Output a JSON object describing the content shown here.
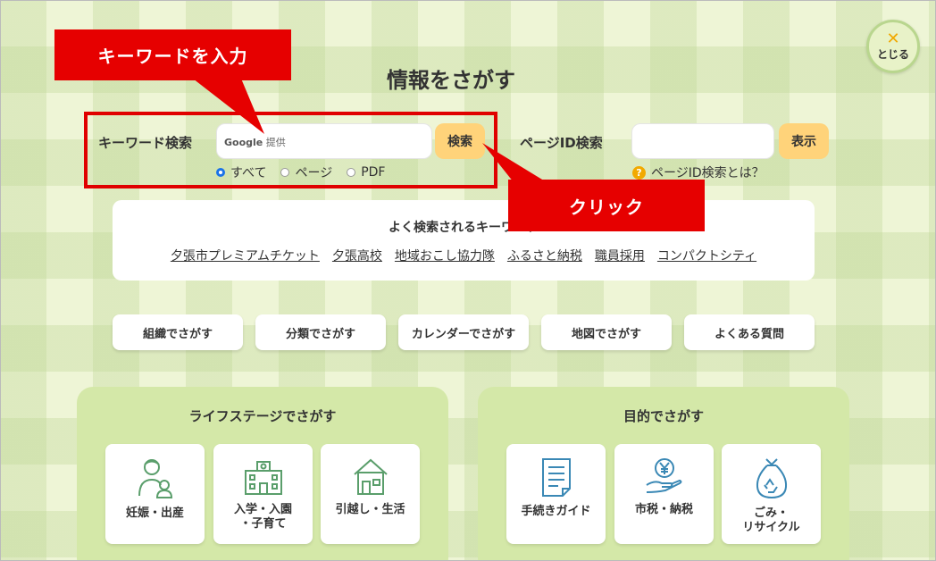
{
  "close": {
    "label": "とじる"
  },
  "page_title": "情報をさがす",
  "keyword_search": {
    "label": "キーワード検索",
    "google_tag_brand": "Google",
    "google_tag_text": "提供",
    "button": "検索",
    "radios": [
      {
        "label": "すべて",
        "checked": true
      },
      {
        "label": "ページ",
        "checked": false
      },
      {
        "label": "PDF",
        "checked": false
      }
    ]
  },
  "pageid_search": {
    "label": "ページID検索",
    "button": "表示",
    "help": "ページID検索とは？"
  },
  "annotations": {
    "keyword_input": "キーワードを入力",
    "click": "クリック",
    "color": "#e60000"
  },
  "popular": {
    "title": "よく検索されるキーワード",
    "links": [
      "夕張市プレミアムチケット",
      "夕張高校",
      "地域おこし協力隊",
      "ふるさと納税",
      "職員採用",
      "コンパクトシティ"
    ]
  },
  "nav_buttons": [
    "組織でさがす",
    "分類でさがす",
    "カレンダーでさがす",
    "地図でさがす",
    "よくある質問"
  ],
  "life_stage": {
    "title": "ライフステージでさがす",
    "tiles": [
      {
        "label": "妊娠・出産",
        "icon": "parent-child-icon"
      },
      {
        "label": "入学・入園\n・子育て",
        "icon": "school-building-icon"
      },
      {
        "label": "引越し・生活",
        "icon": "house-icon"
      }
    ]
  },
  "purpose": {
    "title": "目的でさがす",
    "tiles": [
      {
        "label": "手続きガイド",
        "icon": "document-icon"
      },
      {
        "label": "市税・納税",
        "icon": "yen-coin-icon"
      },
      {
        "label": "ごみ・\nリサイクル",
        "icon": "recycle-bag-icon"
      }
    ]
  },
  "colors": {
    "accent_yellow": "#ffd37a",
    "panel_green": "#d4e8a8",
    "icon_green": "#5a9e6b",
    "icon_blue": "#3a88b5"
  }
}
